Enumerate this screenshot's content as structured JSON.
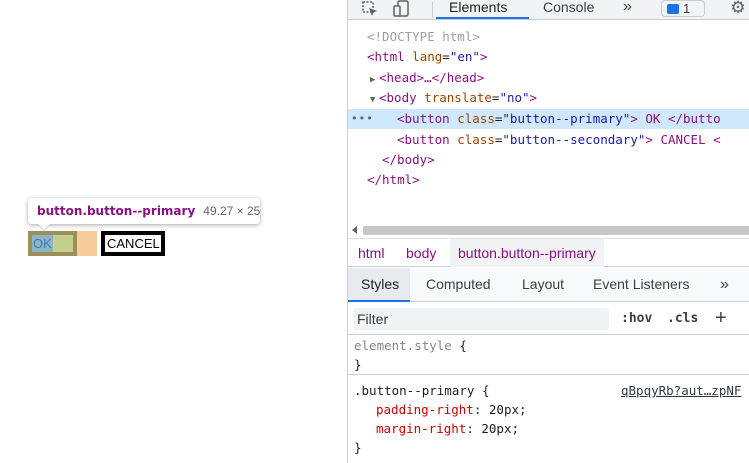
{
  "page": {
    "tooltip": {
      "selector": "button.button--primary",
      "dimensions": "49.27 × 25"
    },
    "ok_label": "OK",
    "cancel_label": "CANCEL"
  },
  "devtools": {
    "toolbar": {
      "tabs": [
        "Elements",
        "Console"
      ],
      "active_tab": "Elements",
      "more": "»",
      "issues_count": "1"
    },
    "dom_tree": {
      "doctype": "<!DOCTYPE html>",
      "html_open": {
        "tag": "<html",
        "attr": "lang",
        "value": "\"en\"",
        "close": ">"
      },
      "head": "<head>…</head>",
      "body_open": {
        "tag": "<body",
        "attr": "translate",
        "value": "\"no\"",
        "close": ">"
      },
      "button1": {
        "tag": "<button",
        "attr": "class",
        "value": "\"button--primary\"",
        "text": "> OK </butto"
      },
      "button2": {
        "tag": "<button",
        "attr": "class",
        "value": "\"button--secondary\"",
        "text": "> CANCEL <"
      },
      "body_close": "</body>",
      "html_close": "</html>"
    },
    "breadcrumbs": [
      "html",
      "body",
      "button.button--primary"
    ],
    "subtabs": [
      "Styles",
      "Computed",
      "Layout",
      "Event Listeners",
      "»"
    ],
    "active_subtab": "Styles",
    "filter": {
      "placeholder": "Filter",
      "hov": ":hov",
      "cls": ".cls",
      "add": "+"
    },
    "rules": {
      "element_style": {
        "selector": "element.style",
        "open": " {",
        "close": "}"
      },
      "primary": {
        "selector": ".button--primary",
        "open": " {",
        "source": "qBpqyRb?aut…zpNF",
        "declarations": [
          {
            "prop": "padding-right",
            "value": "20px"
          },
          {
            "prop": "margin-right",
            "value": "20px"
          }
        ],
        "close": "}"
      }
    }
  },
  "colors": {
    "accent": "#1a73e8",
    "tag": "#881280",
    "attr_name": "#994500",
    "attr_value": "#1a1aa6",
    "margin_highlight": "#f8cb9c",
    "padding_highlight": "#c3d08b",
    "content_highlight": "#8cb6c0"
  }
}
